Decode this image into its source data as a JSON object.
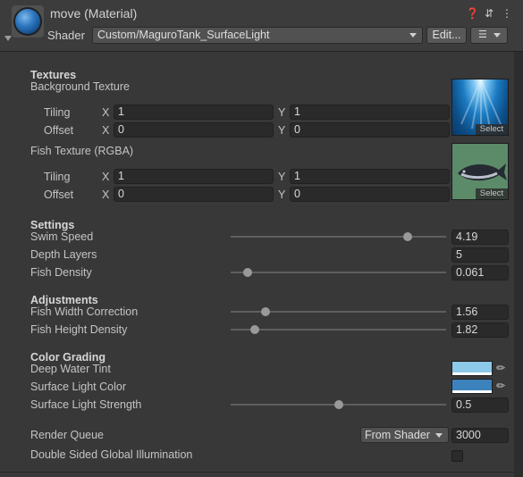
{
  "header": {
    "title": "move (Material)",
    "shader_label": "Shader",
    "shader_value": "Custom/MaguroTank_SurfaceLight",
    "edit_label": "Edit...",
    "icons": [
      "help-icon",
      "preset-icon",
      "kebab-menu-icon"
    ]
  },
  "textures": {
    "section": "Textures",
    "background": {
      "label": "Background Texture",
      "tiling_label": "Tiling",
      "offset_label": "Offset",
      "tiling_x": "1",
      "tiling_y": "1",
      "offset_x": "0",
      "offset_y": "0",
      "select_label": "Select"
    },
    "fish": {
      "label": "Fish Texture (RGBA)",
      "tiling_label": "Tiling",
      "offset_label": "Offset",
      "tiling_x": "1",
      "tiling_y": "1",
      "offset_x": "0",
      "offset_y": "0",
      "select_label": "Select"
    },
    "x_label": "X",
    "y_label": "Y"
  },
  "settings": {
    "section": "Settings",
    "swim_speed": {
      "label": "Swim Speed",
      "value": "4.19",
      "fraction": 0.82
    },
    "depth_layers": {
      "label": "Depth Layers",
      "value": "5"
    },
    "fish_density": {
      "label": "Fish Density",
      "value": "0.061",
      "fraction": 0.08
    }
  },
  "adjustments": {
    "section": "Adjustments",
    "width_correction": {
      "label": "Fish Width Correction",
      "value": "1.56",
      "fraction": 0.16
    },
    "height_density": {
      "label": "Fish Height Density",
      "value": "1.82",
      "fraction": 0.11
    }
  },
  "color_grading": {
    "section": "Color Grading",
    "deep_tint": {
      "label": "Deep Water Tint",
      "color": "#8dc9e8"
    },
    "surface_color": {
      "label": "Surface Light Color",
      "color": "#3c83bd"
    },
    "surface_strength": {
      "label": "Surface Light Strength",
      "value": "0.5",
      "fraction": 0.5
    }
  },
  "render": {
    "queue_label": "Render Queue",
    "queue_mode": "From Shader",
    "queue_value": "3000",
    "dsgi_label": "Double Sided Global Illumination"
  }
}
